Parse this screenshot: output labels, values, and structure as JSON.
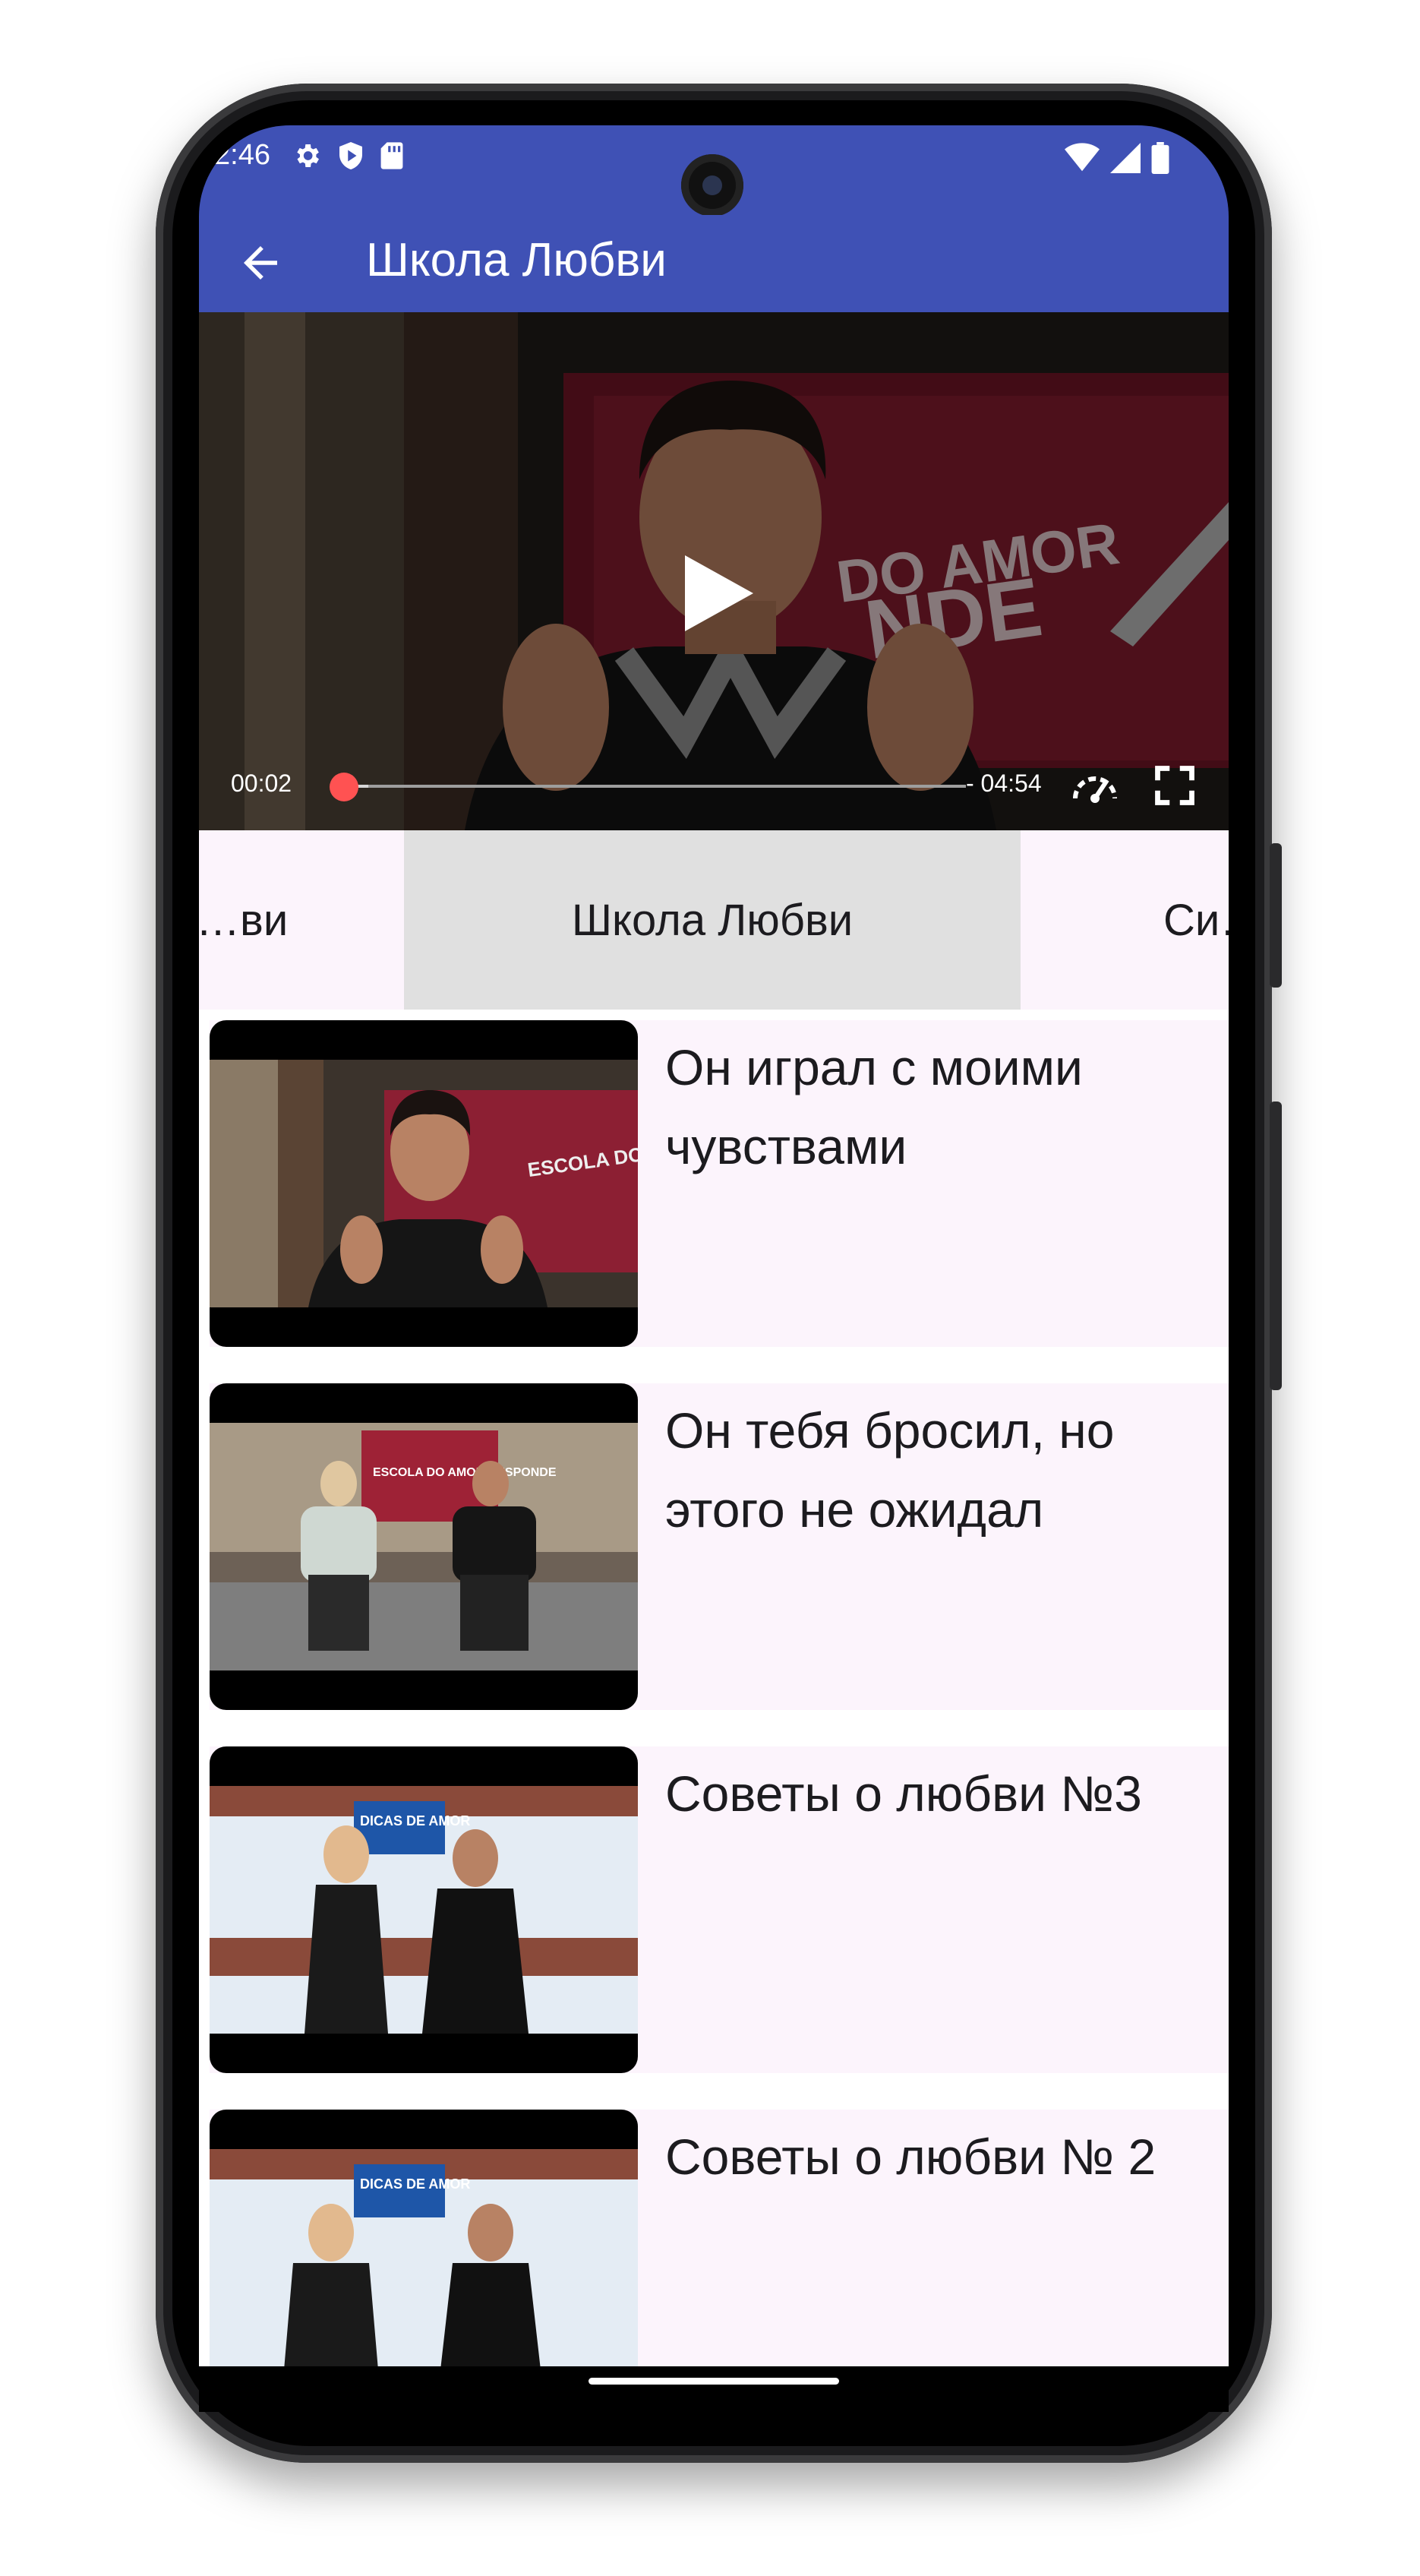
{
  "status_bar": {
    "time": "2:46",
    "left_icons": [
      "settings-icon",
      "shield-play-icon",
      "sd-card-icon"
    ],
    "right_icons": [
      "wifi-icon",
      "cell-signal-icon",
      "battery-icon"
    ]
  },
  "app_bar": {
    "title": "Школа Любви",
    "back_icon": "arrow-back-icon",
    "color": "#3f51b5"
  },
  "player": {
    "current_time": "00:02",
    "remaining_time": "- 04:54",
    "progress": 0.01,
    "buffered": 0.04,
    "accent": "#ff5252"
  },
  "tabs": [
    {
      "label": "…ви",
      "active": false
    },
    {
      "label": "Школа Любви",
      "active": true
    },
    {
      "label": "Си…",
      "active": false
    }
  ],
  "videos": [
    {
      "title": "Он играл с моими чувствами",
      "thumb_text": "ESCOLA DO AMOR RESPONDE"
    },
    {
      "title": "Он тебя бросил, но этого не ожидал",
      "thumb_text": "ESCOLA DO AMOR RESPONDE"
    },
    {
      "title": "Советы о любви №3",
      "thumb_text": "DICAS DE AMOR"
    },
    {
      "title": "Советы о любви № 2",
      "thumb_text": "DICAS DE AMOR"
    }
  ],
  "player_overlay_text": [
    "DO AMOR",
    "NDE"
  ]
}
